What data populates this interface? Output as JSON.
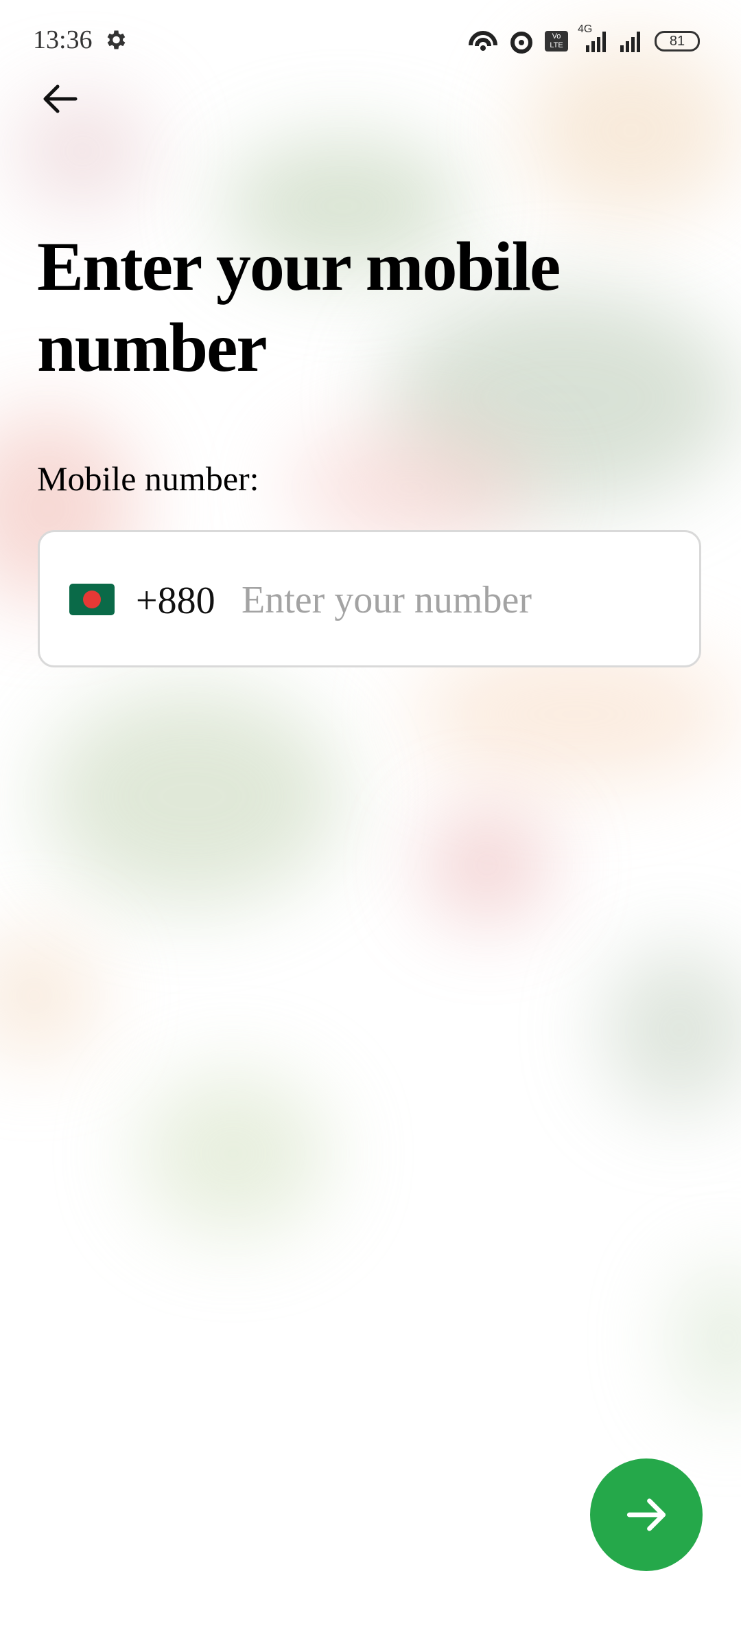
{
  "status_bar": {
    "time": "13:36",
    "battery": "81",
    "network": "4G",
    "volte": "Vo LTE"
  },
  "header": {
    "title": "Enter your mobile number"
  },
  "form": {
    "label": "Mobile number:",
    "country_code": "+880",
    "country_flag": "bangladesh-flag-icon",
    "placeholder": "Enter your number",
    "value": ""
  },
  "colors": {
    "accent": "#25a84a",
    "flag_green": "#0a6a48",
    "flag_red": "#e53935"
  },
  "icons": {
    "back": "arrow-left-icon",
    "next": "arrow-right-icon",
    "settings": "gear-icon"
  }
}
